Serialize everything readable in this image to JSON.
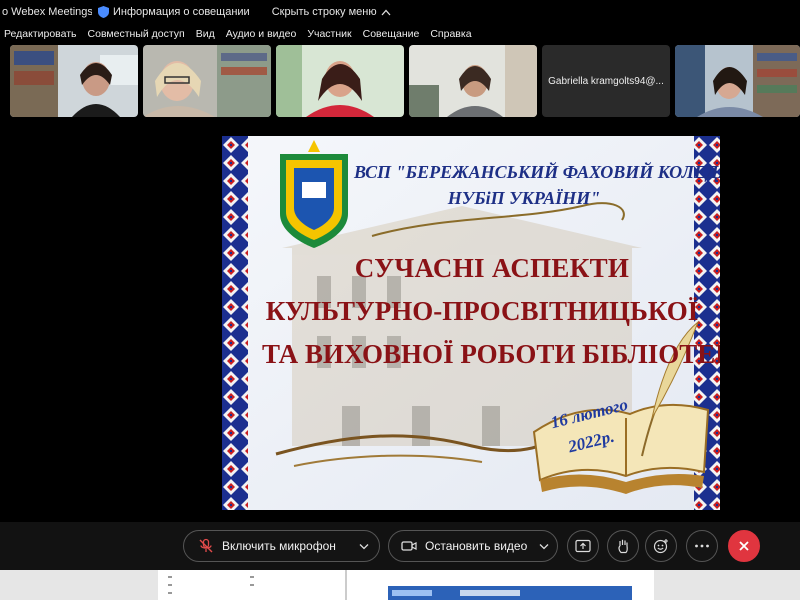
{
  "titlebar": {
    "app_title": "o Webex Meetings",
    "meeting_info": "Информация о совещании",
    "hide_bar": "Скрыть строку меню"
  },
  "menu": {
    "items": [
      "Редактировать",
      "Совместный доступ",
      "Вид",
      "Аудио и видео",
      "Участник",
      "Совещание",
      "Справка"
    ]
  },
  "participants": {
    "name_tile": "Gabriella kramgolts94@..."
  },
  "slide": {
    "org_line1": "ВСП \"БЕРЕЖАНСЬКИЙ ФАХОВИЙ КОЛЕДЖ",
    "org_line2": "НУБіП УКРАЇНИ\"",
    "title_line1": "СУЧАСНІ АСПЕКТИ",
    "title_line2": "КУЛЬТУРНО-ПРОСВІТНИЦЬКОЇ",
    "title_line3": "ТА ВИХОВНОЇ РОБОТИ БІБЛІОТЕКИ",
    "date_line1": "16 лютого",
    "date_line2": "2022р."
  },
  "controls": {
    "mic_label": "Включить микрофон",
    "video_label": "Остановить видео"
  },
  "colors": {
    "end_call": "#e0353f",
    "slide_title": "#8a1216",
    "slide_org": "#1d2f86"
  }
}
